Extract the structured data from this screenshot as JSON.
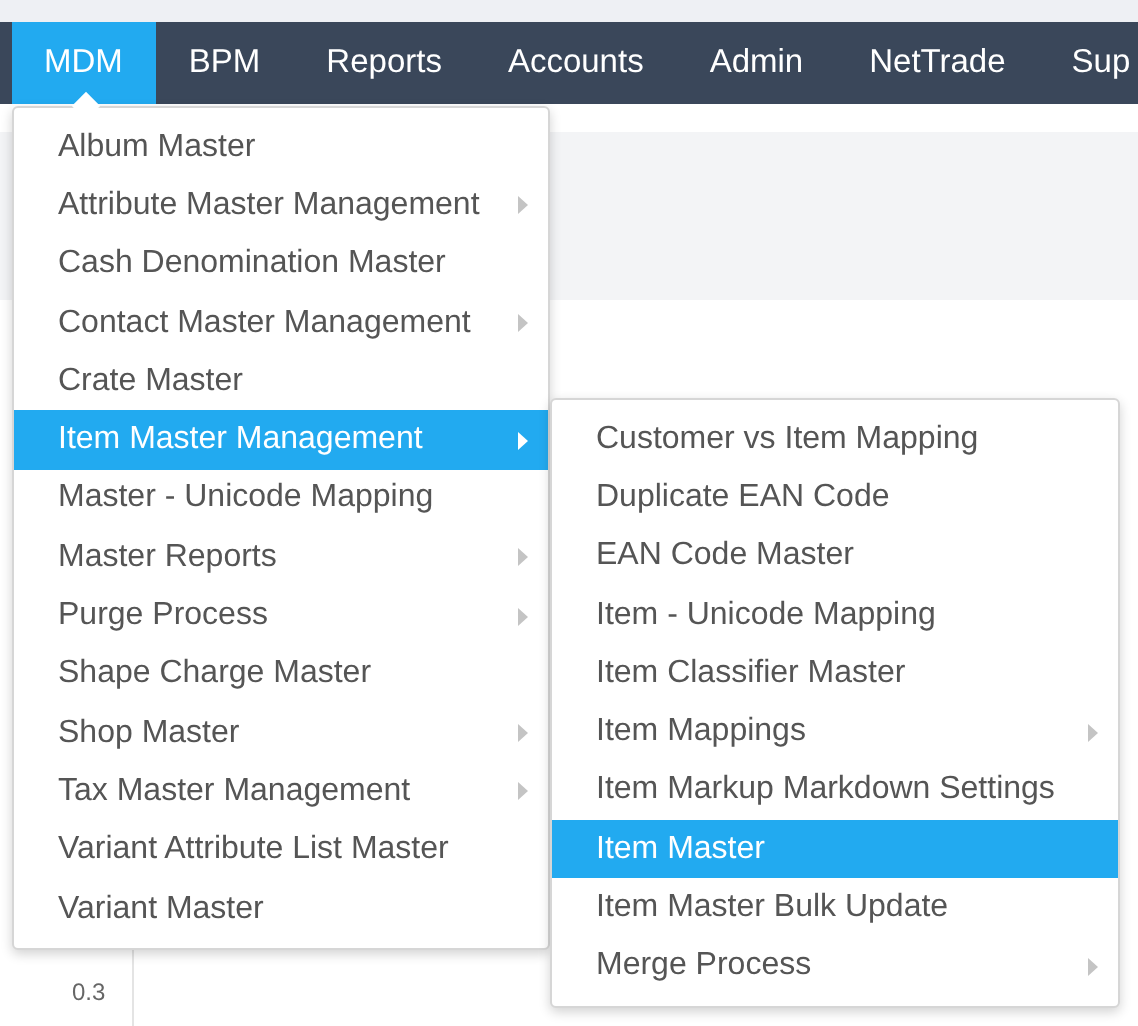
{
  "nav": {
    "items": [
      {
        "label": "MDM",
        "selected": true
      },
      {
        "label": "BPM",
        "selected": false
      },
      {
        "label": "Reports",
        "selected": false
      },
      {
        "label": "Accounts",
        "selected": false
      },
      {
        "label": "Admin",
        "selected": false
      },
      {
        "label": "NetTrade",
        "selected": false
      },
      {
        "label": "Sup",
        "selected": false
      }
    ]
  },
  "page": {
    "chart_axis_label": "0.3"
  },
  "menu": {
    "items": [
      {
        "label": "Album Master",
        "has_submenu": false,
        "selected": false
      },
      {
        "label": "Attribute Master Management",
        "has_submenu": true,
        "selected": false
      },
      {
        "label": "Cash Denomination Master",
        "has_submenu": false,
        "selected": false
      },
      {
        "label": "Contact Master Management",
        "has_submenu": true,
        "selected": false
      },
      {
        "label": "Crate Master",
        "has_submenu": false,
        "selected": false
      },
      {
        "label": "Item Master Management",
        "has_submenu": true,
        "selected": true
      },
      {
        "label": "Master - Unicode Mapping",
        "has_submenu": false,
        "selected": false
      },
      {
        "label": "Master Reports",
        "has_submenu": true,
        "selected": false
      },
      {
        "label": "Purge Process",
        "has_submenu": true,
        "selected": false
      },
      {
        "label": "Shape Charge Master",
        "has_submenu": false,
        "selected": false
      },
      {
        "label": "Shop Master",
        "has_submenu": true,
        "selected": false
      },
      {
        "label": "Tax Master Management",
        "has_submenu": true,
        "selected": false
      },
      {
        "label": "Variant Attribute List Master",
        "has_submenu": false,
        "selected": false
      },
      {
        "label": "Variant Master",
        "has_submenu": false,
        "selected": false
      }
    ]
  },
  "submenu": {
    "items": [
      {
        "label": "Customer vs Item Mapping",
        "has_submenu": false,
        "selected": false
      },
      {
        "label": "Duplicate EAN Code",
        "has_submenu": false,
        "selected": false
      },
      {
        "label": "EAN Code Master",
        "has_submenu": false,
        "selected": false
      },
      {
        "label": "Item - Unicode Mapping",
        "has_submenu": false,
        "selected": false
      },
      {
        "label": "Item Classifier Master",
        "has_submenu": false,
        "selected": false
      },
      {
        "label": "Item Mappings",
        "has_submenu": true,
        "selected": false
      },
      {
        "label": "Item Markup Markdown Settings",
        "has_submenu": false,
        "selected": false
      },
      {
        "label": "Item Master",
        "has_submenu": false,
        "selected": true
      },
      {
        "label": "Item Master Bulk Update",
        "has_submenu": false,
        "selected": false
      },
      {
        "label": "Merge Process",
        "has_submenu": true,
        "selected": false
      }
    ]
  }
}
